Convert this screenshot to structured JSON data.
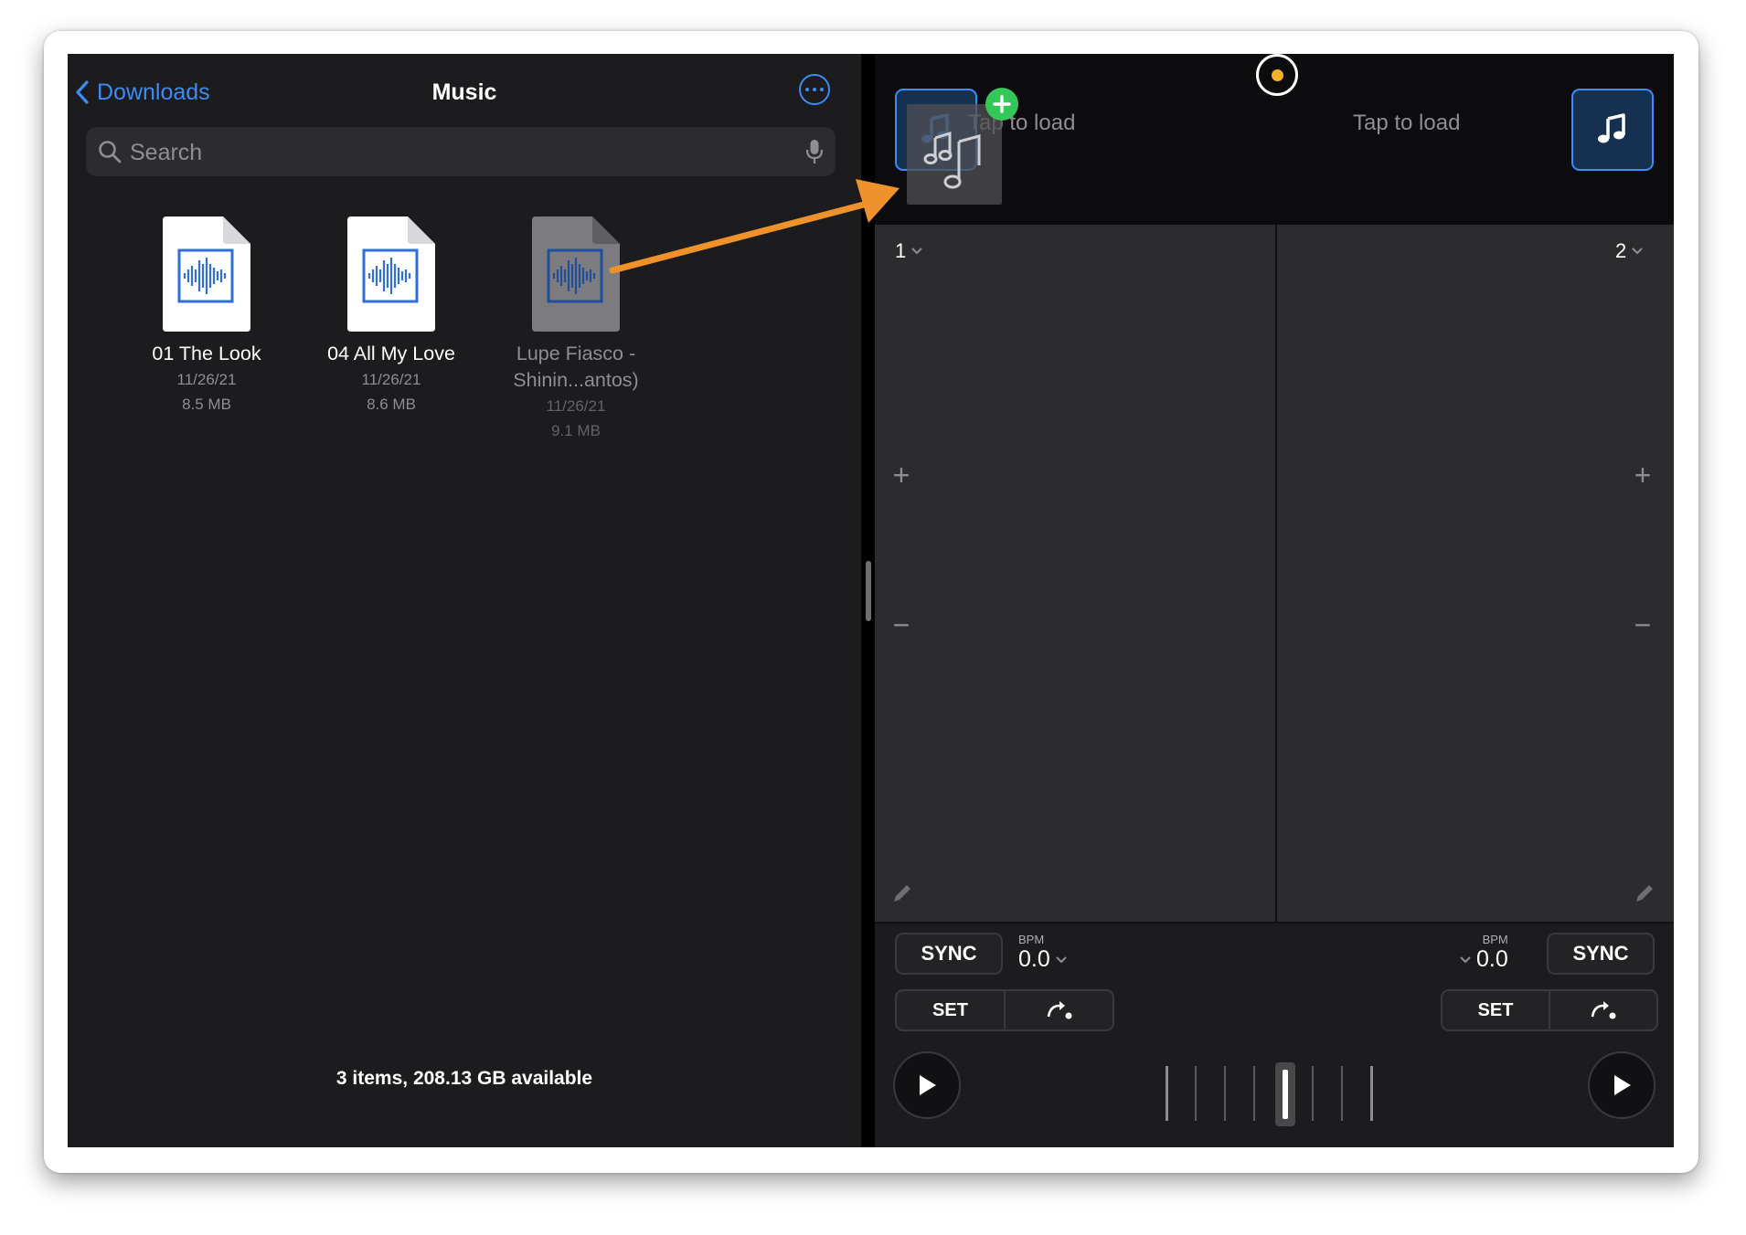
{
  "files_app": {
    "back_label": "Downloads",
    "title": "Music",
    "search_placeholder": "Search",
    "items": [
      {
        "name": "01 The Look",
        "date": "11/26/21",
        "size": "8.5 MB"
      },
      {
        "name": "04 All My Love",
        "date": "11/26/21",
        "size": "8.6 MB"
      },
      {
        "name_line1": "Lupe Fiasco -",
        "name_line2": "Shinin...antos)",
        "date": "11/26/21",
        "size": "9.1 MB",
        "state": "dragging"
      }
    ],
    "footer": "3 items, 208.13 GB available"
  },
  "dj_app": {
    "deck_left": {
      "tap_label": "Tap to load",
      "number": "1",
      "bpm_label": "BPM",
      "bpm": "0.0",
      "sync": "SYNC",
      "set": "SET"
    },
    "deck_right": {
      "tap_label": "Tap to load",
      "number": "2",
      "bpm_label": "BPM",
      "bpm": "0.0",
      "sync": "SYNC",
      "set": "SET"
    },
    "zoom_in": "+",
    "zoom_out": "−",
    "status_indicator_color": "#f5b025"
  },
  "colors": {
    "accent": "#3b8cf7",
    "drop_badge": "#34c759",
    "annotation_arrow": "#f0922b"
  }
}
